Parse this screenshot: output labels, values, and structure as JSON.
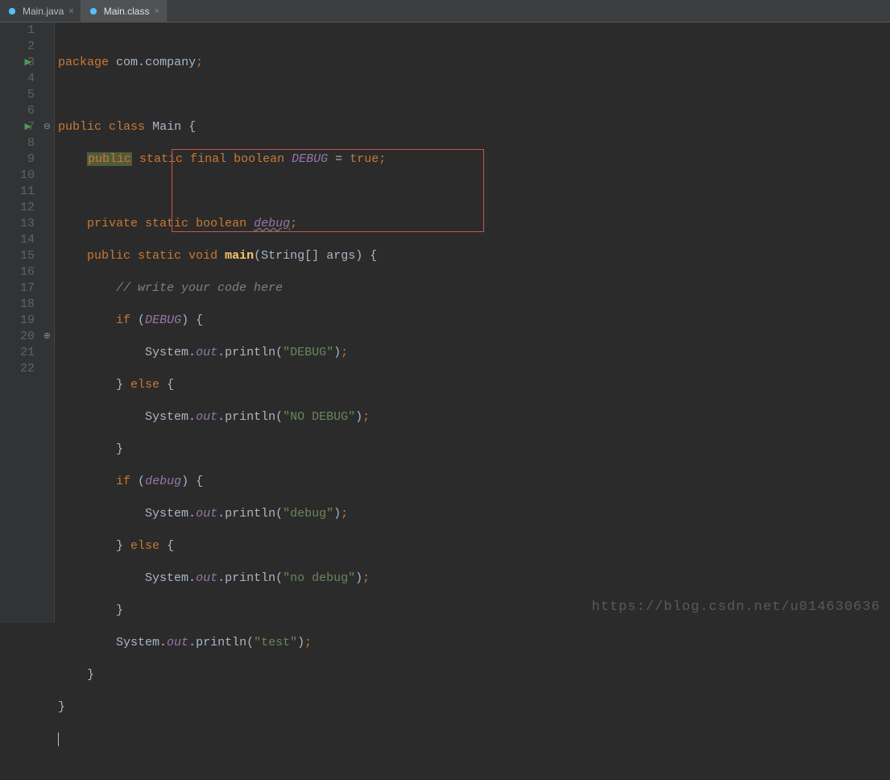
{
  "tabs": [
    {
      "name": "Main.java",
      "active": false
    },
    {
      "name": "Main.class",
      "active": true
    }
  ],
  "lineCount": 22,
  "gutter": {
    "runMarkers": [
      3,
      7
    ],
    "foldOpen": [
      7
    ],
    "foldClose": [
      20
    ]
  },
  "watermark": "https://blog.csdn.net/u014630636",
  "tokens": {
    "package": "package",
    "com": "com",
    "company": "company",
    "public": "public",
    "class": "class",
    "Main": "Main",
    "static": "static",
    "final": "final",
    "boolean": "boolean",
    "DEBUG": "DEBUG",
    "eq": "=",
    "true": "true",
    "private": "private",
    "debug": "debug",
    "void": "void",
    "main": "main",
    "String": "String",
    "args": "args",
    "comment": "// write your code here",
    "if": "if",
    "else": "else",
    "System": "System",
    "out": "out",
    "println": "println",
    "s_DEBUG": "\"DEBUG\"",
    "s_NO_DEBUG": "\"NO DEBUG\"",
    "s_debug": "\"debug\"",
    "s_no_debug": "\"no debug\"",
    "s_test": "\"test\"",
    "semi": ";",
    "dot": ".",
    "lbrace": "{",
    "rbrace": "}",
    "lparen": "(",
    "rparen": ")",
    "lbrack": "[",
    "rbrack": "]"
  },
  "redbox": {
    "startLine": 9,
    "endLine": 13
  }
}
